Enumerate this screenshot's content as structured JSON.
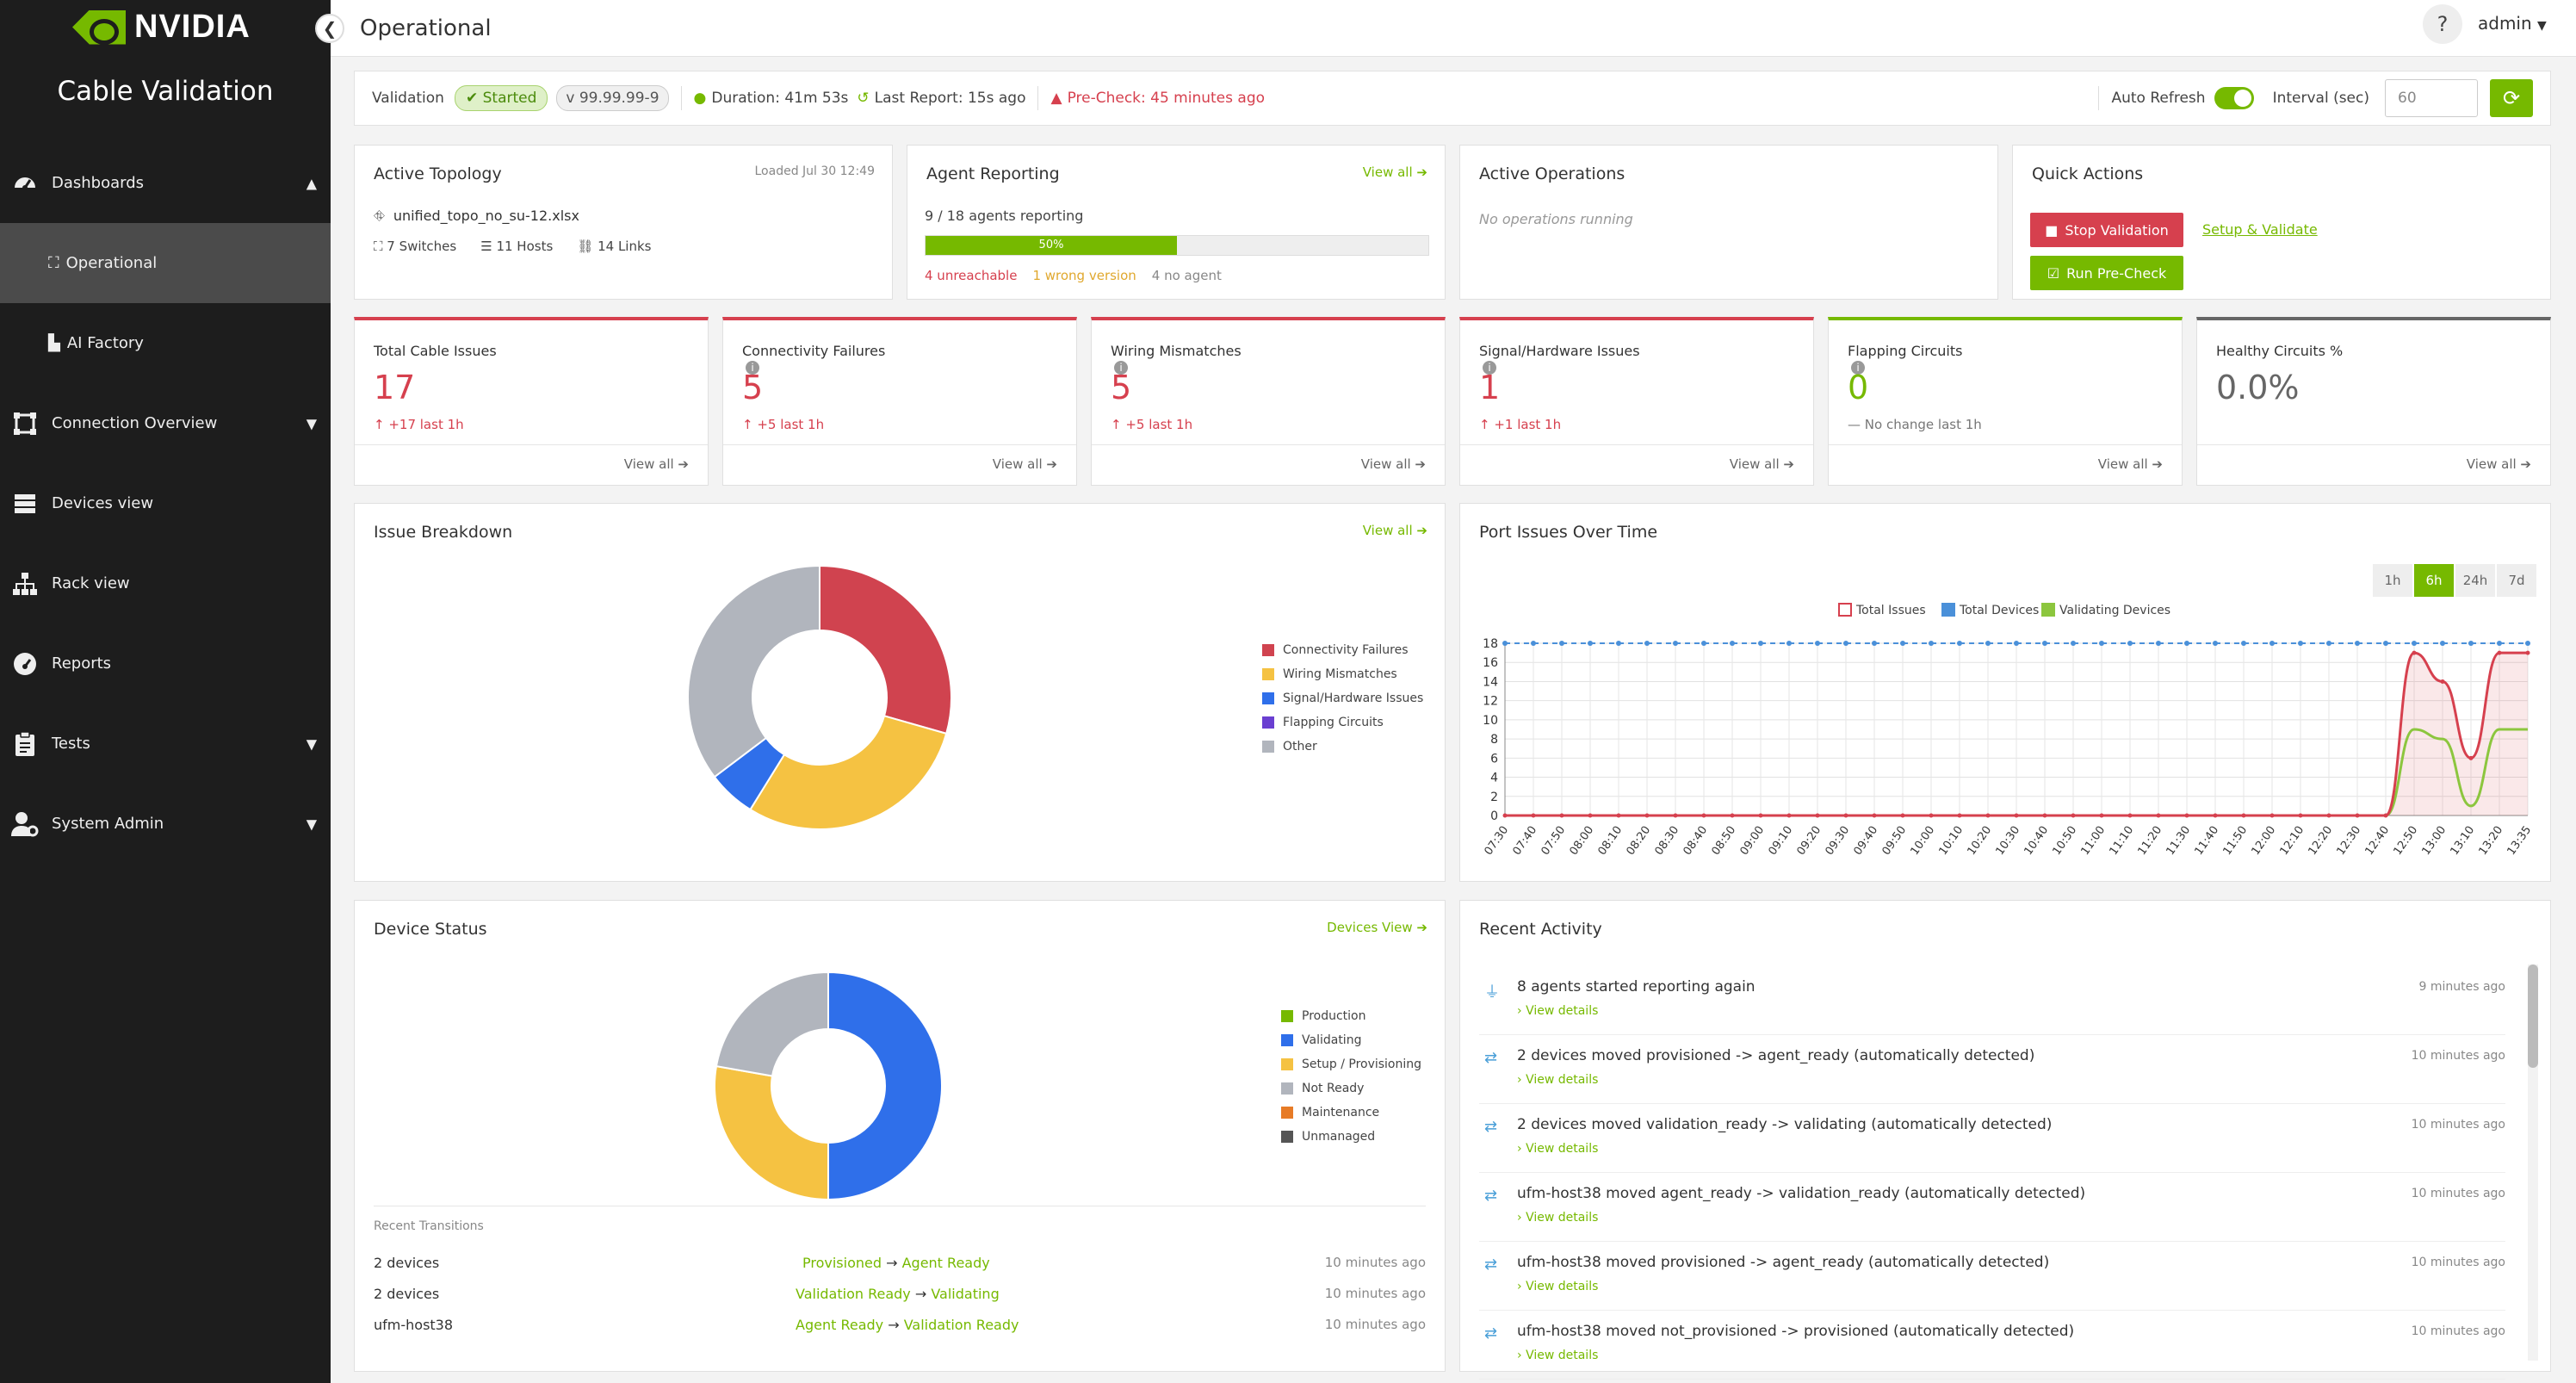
{
  "sidebar": {
    "logo_text": "NVIDIA",
    "app_title": "Cable Validation",
    "items": [
      {
        "label": "Dashboards",
        "icon": "dashboard-icon"
      },
      {
        "label": "Operational",
        "icon": "network-icon"
      },
      {
        "label": "AI Factory",
        "icon": "bar-chart-icon"
      },
      {
        "label": "Connection Overview",
        "icon": "connection-icon"
      },
      {
        "label": "Devices view",
        "icon": "server-icon"
      },
      {
        "label": "Rack view",
        "icon": "hierarchy-icon"
      },
      {
        "label": "Reports",
        "icon": "report-icon"
      },
      {
        "label": "Tests",
        "icon": "clipboard-icon"
      },
      {
        "label": "System Admin",
        "icon": "admin-icon"
      }
    ]
  },
  "header": {
    "title": "Operational",
    "help": "?",
    "user": "admin"
  },
  "status": {
    "validation_label": "Validation",
    "state": "Started",
    "version": "v 99.99.99-9",
    "duration": "Duration: 41m 53s",
    "last_report": "Last Report: 15s ago",
    "precheck": "Pre-Check: 45 minutes ago",
    "auto_refresh": "Auto Refresh",
    "interval_label": "Interval (sec)",
    "interval_placeholder": "60"
  },
  "topology": {
    "title": "Active Topology",
    "loaded": "Loaded Jul 30 12:49",
    "file": "unified_topo_no_su-12.xlsx",
    "switches": "7 Switches",
    "hosts": "11 Hosts",
    "links": "14 Links"
  },
  "agents": {
    "title": "Agent Reporting",
    "view_all": "View all",
    "reporting": "9 / 18 agents reporting",
    "progress_label": "50%",
    "progress": 0.5,
    "unreachable": "4 unreachable",
    "wrong_version": "1 wrong version",
    "no_agent": "4 no agent"
  },
  "operations": {
    "title": "Active Operations",
    "empty": "No operations running"
  },
  "quick": {
    "title": "Quick Actions",
    "stop": "Stop Validation",
    "setup": "Setup & Validate",
    "precheck": "Run Pre-Check"
  },
  "kpis": [
    {
      "label": "Total Cable Issues",
      "value": "17",
      "delta": "+17 last 1h",
      "info": false,
      "color": "#d6404e",
      "view": "View all"
    },
    {
      "label": "Connectivity Failures",
      "value": "5",
      "delta": "+5 last 1h",
      "info": true,
      "color": "#d6404e",
      "view": "View all"
    },
    {
      "label": "Wiring Mismatches",
      "value": "5",
      "delta": "+5 last 1h",
      "info": true,
      "color": "#d6404e",
      "view": "View all"
    },
    {
      "label": "Signal/Hardware Issues",
      "value": "1",
      "delta": "+1 last 1h",
      "info": true,
      "color": "#d6404e",
      "view": "View all"
    },
    {
      "label": "Flapping Circuits",
      "value": "0",
      "delta": "No change last 1h",
      "info": true,
      "color": "#76b900",
      "view": "View all"
    },
    {
      "label": "Healthy Circuits %",
      "value": "0.0%",
      "delta": "",
      "info": false,
      "color": "#666666",
      "view": "View all"
    }
  ],
  "issue_breakdown": {
    "title": "Issue Breakdown",
    "view_all": "View all"
  },
  "port_issues": {
    "title": "Port Issues Over Time",
    "ranges": [
      "1h",
      "6h",
      "24h",
      "7d"
    ],
    "active_range": "6h"
  },
  "device_status": {
    "title": "Device Status",
    "link": "Devices View",
    "transitions_title": "Recent Transitions",
    "transitions": [
      {
        "device": "2 devices",
        "from": "Provisioned",
        "to": "Agent Ready",
        "time": "10 minutes ago"
      },
      {
        "device": "2 devices",
        "from": "Validation Ready",
        "to": "Validating",
        "time": "10 minutes ago"
      },
      {
        "device": "ufm-host38",
        "from": "Agent Ready",
        "to": "Validation Ready",
        "time": "10 minutes ago"
      }
    ]
  },
  "activity": {
    "title": "Recent Activity",
    "details": "View details",
    "items": [
      {
        "text": "8 agents started reporting again",
        "time": "9 minutes ago",
        "icon": "plug-icon"
      },
      {
        "text": "2 devices moved provisioned -> agent_ready (automatically detected)",
        "time": "10 minutes ago",
        "icon": "exchange-icon"
      },
      {
        "text": "2 devices moved validation_ready -> validating (automatically detected)",
        "time": "10 minutes ago",
        "icon": "exchange-icon"
      },
      {
        "text": "ufm-host38 moved agent_ready -> validation_ready (automatically detected)",
        "time": "10 minutes ago",
        "icon": "exchange-icon"
      },
      {
        "text": "ufm-host38 moved provisioned -> agent_ready (automatically detected)",
        "time": "10 minutes ago",
        "icon": "exchange-icon"
      },
      {
        "text": "ufm-host38 moved not_provisioned -> provisioned (automatically detected)",
        "time": "10 minutes ago",
        "icon": "exchange-icon"
      }
    ]
  },
  "chart_data": [
    {
      "type": "pie",
      "title": "Issue Breakdown",
      "donut": true,
      "categories": [
        "Connectivity Failures",
        "Wiring Mismatches",
        "Signal/Hardware Issues",
        "Flapping Circuits",
        "Other"
      ],
      "values": [
        5,
        5,
        1,
        0,
        6
      ],
      "colors": [
        "#d0434f",
        "#f5c242",
        "#2f6fea",
        "#6a3fd1",
        "#b1b5bd"
      ],
      "legend": "right"
    },
    {
      "type": "pie",
      "title": "Device Status",
      "donut": true,
      "categories": [
        "Production",
        "Validating",
        "Setup / Provisioning",
        "Not Ready",
        "Maintenance",
        "Unmanaged"
      ],
      "values": [
        0,
        9,
        5,
        4,
        0,
        0
      ],
      "colors": [
        "#76b900",
        "#2f6fea",
        "#f5c242",
        "#b1b5bd",
        "#e77b26",
        "#555555"
      ],
      "legend": "right"
    },
    {
      "type": "line",
      "title": "Port Issues Over Time",
      "x": [
        "07:30",
        "07:40",
        "07:50",
        "08:00",
        "08:10",
        "08:20",
        "08:30",
        "08:40",
        "08:50",
        "09:00",
        "09:10",
        "09:20",
        "09:30",
        "09:40",
        "09:50",
        "10:00",
        "10:10",
        "10:20",
        "10:30",
        "10:40",
        "10:50",
        "11:00",
        "11:10",
        "11:20",
        "11:30",
        "11:40",
        "11:50",
        "12:00",
        "12:10",
        "12:20",
        "12:30",
        "12:40",
        "12:50",
        "13:00",
        "13:10",
        "13:20",
        "13:35"
      ],
      "ylim": [
        0,
        18
      ],
      "yticks": [
        0,
        2,
        4,
        6,
        8,
        10,
        12,
        14,
        16,
        18
      ],
      "grid": true,
      "legend": "top",
      "series": [
        {
          "name": "Total Issues",
          "color": "#d6404e",
          "values": [
            0,
            0,
            0,
            0,
            0,
            0,
            0,
            0,
            0,
            0,
            0,
            0,
            0,
            0,
            0,
            0,
            0,
            0,
            0,
            0,
            0,
            0,
            0,
            0,
            0,
            0,
            0,
            0,
            0,
            0,
            0,
            0,
            17,
            14,
            6,
            17,
            17
          ]
        },
        {
          "name": "Total Devices",
          "color": "#4a90d9",
          "values": [
            18,
            18,
            18,
            18,
            18,
            18,
            18,
            18,
            18,
            18,
            18,
            18,
            18,
            18,
            18,
            18,
            18,
            18,
            18,
            18,
            18,
            18,
            18,
            18,
            18,
            18,
            18,
            18,
            18,
            18,
            18,
            18,
            18,
            18,
            18,
            18,
            18
          ]
        },
        {
          "name": "Validating Devices",
          "color": "#8cc63e",
          "values": [
            0,
            0,
            0,
            0,
            0,
            0,
            0,
            0,
            0,
            0,
            0,
            0,
            0,
            0,
            0,
            0,
            0,
            0,
            0,
            0,
            0,
            0,
            0,
            0,
            0,
            0,
            0,
            0,
            0,
            0,
            0,
            0,
            9,
            8,
            1,
            9,
            9
          ]
        }
      ]
    }
  ]
}
